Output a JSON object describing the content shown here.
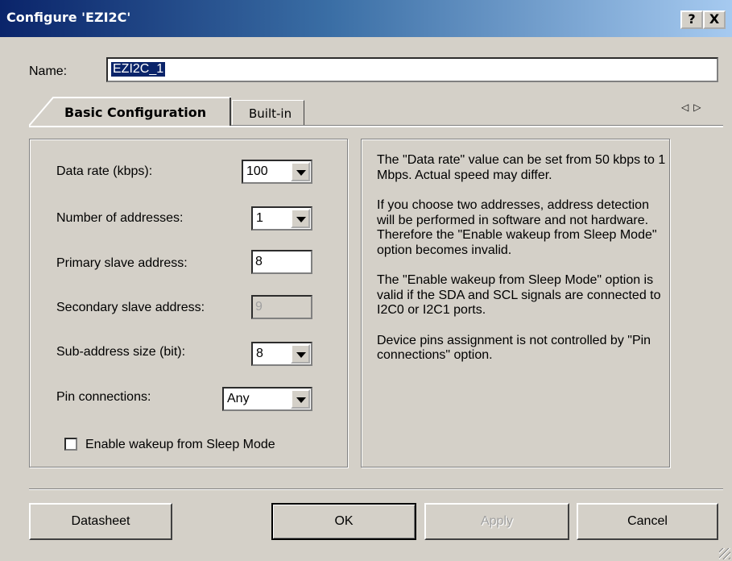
{
  "window": {
    "title": "Configure 'EZI2C'",
    "help_btn": "?",
    "close_btn": "X"
  },
  "name_field": {
    "label": "Name:",
    "value": "EZI2C_1"
  },
  "tabs": [
    {
      "label": "Basic Configuration",
      "active": true
    },
    {
      "label": "Built-in",
      "active": false
    }
  ],
  "tab_scroll": {
    "left": "◁",
    "right": "▷"
  },
  "form": {
    "data_rate": {
      "label": "Data rate (kbps):",
      "value": "100"
    },
    "num_addresses": {
      "label": "Number of addresses:",
      "value": "1"
    },
    "primary_address": {
      "label": "Primary slave address:",
      "value": "8"
    },
    "secondary_address": {
      "label": "Secondary slave address:",
      "value": "9"
    },
    "subaddress_size": {
      "label": "Sub-address size (bit):",
      "value": "8"
    },
    "pin_connections": {
      "label": "Pin connections:",
      "value": "Any"
    },
    "wakeup": {
      "label": "Enable wakeup from Sleep Mode",
      "checked": false
    }
  },
  "help": {
    "p1": "The \"Data rate\" value can be set from 50 kbps to 1 Mbps. Actual speed may differ.",
    "p2": "If you choose two addresses, address detection will be performed in software and not hardware. Therefore the \"Enable wakeup from Sleep Mode\" option becomes invalid.",
    "p3": "The \"Enable wakeup from Sleep Mode\" option is valid if the SDA and SCL signals are connected to I2C0 or I2C1 ports.",
    "p4": "Device pins assignment is not controlled by \"Pin connections\" option."
  },
  "buttons": {
    "datasheet": "Datasheet",
    "ok": "OK",
    "apply": "Apply",
    "cancel": "Cancel"
  }
}
